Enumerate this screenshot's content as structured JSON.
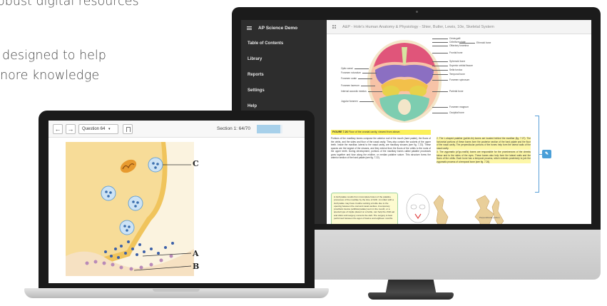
{
  "marketing": {
    "line1": "obust digital resources",
    "line2": "designed to help",
    "line3": "nore knowledge"
  },
  "desktop": {
    "sidebar": {
      "title": "AP Science Demo",
      "items": [
        {
          "label": "Table of Contents"
        },
        {
          "label": "Library"
        },
        {
          "label": "Reports"
        },
        {
          "label": "Settings"
        },
        {
          "label": "Help"
        }
      ]
    },
    "header": {
      "title": "A&P - Hole's Human Anatomy & Physiology - Shier, Butler, Lewis, 10e, Skeletal System"
    },
    "figure": {
      "labels_right": [
        "Crista galli",
        "Cribriform plate",
        "Olfactory foramina",
        "Ethmoid bone",
        "Frontal bone",
        "Sphenoid bone",
        "Superior orbital fissure",
        "Sella turcica",
        "Temporal bone",
        "Foramen spinosum",
        "Parietal bone",
        "Foramen magnum",
        "Occipital bone"
      ],
      "labels_left": [
        "Optic canal",
        "Foramen rotundum",
        "Foramen ovale",
        "Foramen lacerum",
        "Internal acoustic meatus",
        "Jugular foramen"
      ],
      "caption_label": "FIGURE 7.26",
      "caption_text": "Floor of the cranial cavity, viewed from above."
    },
    "paragraph_left": "Portions of the maxillary bones compose the anterior roof of the mouth (hard palate), the floors of the orbits, and the sides and floor of the nasal cavity. They also contain the sockets of the upper teeth. Inside the maxillae, lateral to the nasal cavity, are maxillary sinuses (see fig. 7.23). These spaces are the largest of the sinuses, and they extend from the floors of the orbits to the roots of the upper teeth. During development, portions of the maxillary bones called palatine processes grow together and fuse along the midline, or median palatine suture. This structure forms the anterior section of the hard palate (see fig. 7.22).",
    "paragraph_right_1": "2. The L-shaped palatine (pal'ah-tin) bones are located behind the maxillae (fig. 7.27). The horizontal portions of these bones form the posterior section of the hard palate and the floor of the nasal cavity. The perpendicular portions of the bones help form the lateral walls of the nasal cavity.",
    "paragraph_right_2": "3. The zygomatic (zi\"go-mat'ik) bones are responsible for the prominences of the cheeks below and to the sides of the eyes. These bones also help form the lateral walls and the floors of the orbits. Each bone has a temporal process, which extends posteriorly to join the zygomatic process of a temporal bone (see fig. 7.26).",
    "callout": "A cleft palate results from incomplete fusion of the palatine processes of the maxillae by the time of birth. An infant with a cleft palate may have trouble sucking a bottle due to the opening between the oral and nasal cavities. A temporary prosthetic device (artificial palate) worn in the mouth, or a special type of nipple placed on a bottle, can help the child eat and drink until surgery corrects the cleft. The surgery is best performed between the ages of twelve and eighteen months.",
    "mini_label": "Perpendicular portion",
    "note_button_icon": "note-icon"
  },
  "laptop": {
    "question_select": "Question 64",
    "section_label": "Section 1: 64/70",
    "progress": 0.914,
    "callouts": [
      "C",
      "A",
      "B"
    ],
    "colors": {
      "accent": "#a7d0ea",
      "cell": "#f0c45c",
      "mitochondria": "#e79a2f",
      "vesicle": "#5d8fc9"
    }
  }
}
